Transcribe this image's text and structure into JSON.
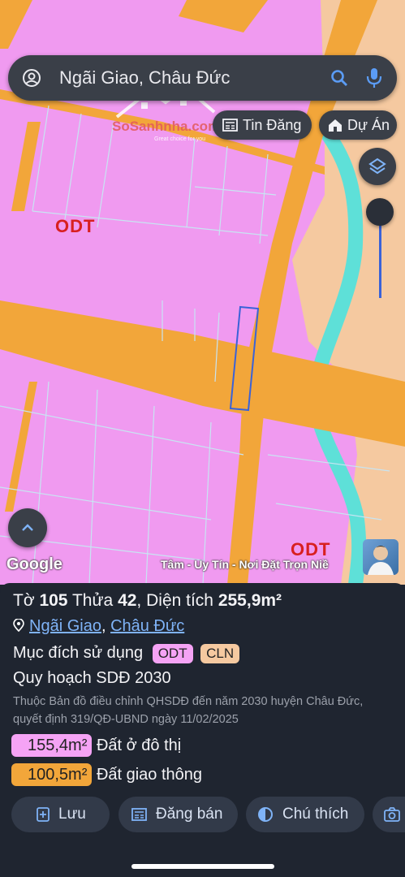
{
  "search": {
    "query": "Ngãi Giao, Châu Đức"
  },
  "chips": {
    "listings": "Tin Đăng",
    "projects": "Dự Án"
  },
  "map": {
    "labels": [
      "ODT",
      "ODT"
    ],
    "attribution": "Google",
    "credit": "Tâm - Uy Tín - Nơi Đặt Trọn Niề",
    "watermark": {
      "brand": "SoSanhnha.com",
      "tagline": "Great choice for you"
    },
    "colors": {
      "residential": "#f09af0",
      "road": "#f2a63a",
      "river": "#5ee0d8",
      "perennial": "#f5c9a0"
    }
  },
  "parcel": {
    "to_label": "Tờ",
    "to_value": "105",
    "thua_label": "Thửa",
    "thua_value": "42",
    "area_label": "Diện tích",
    "area_value": "255,9m²",
    "commune": "Ngãi Giao",
    "separator": ",",
    "district": "Châu Đức",
    "purpose_label": "Mục đích sử dụng",
    "purpose_codes": [
      "ODT",
      "CLN"
    ],
    "plan": "Quy hoạch SDĐ 2030",
    "note": "Thuộc Bản đồ điều chỉnh QHSDĐ đến năm 2030 huyện Châu Đức, quyết định 319/QĐ-UBND ngày 11/02/2025",
    "areas": [
      {
        "value": "155,4m²",
        "label": "Đất ở đô thị",
        "color": "#f5a3f5"
      },
      {
        "value": "100,5m²",
        "label": "Đất giao thông",
        "color": "#f2a63a"
      }
    ]
  },
  "actions": {
    "save": "Lưu",
    "post": "Đăng bán",
    "legend": "Chú thích"
  }
}
